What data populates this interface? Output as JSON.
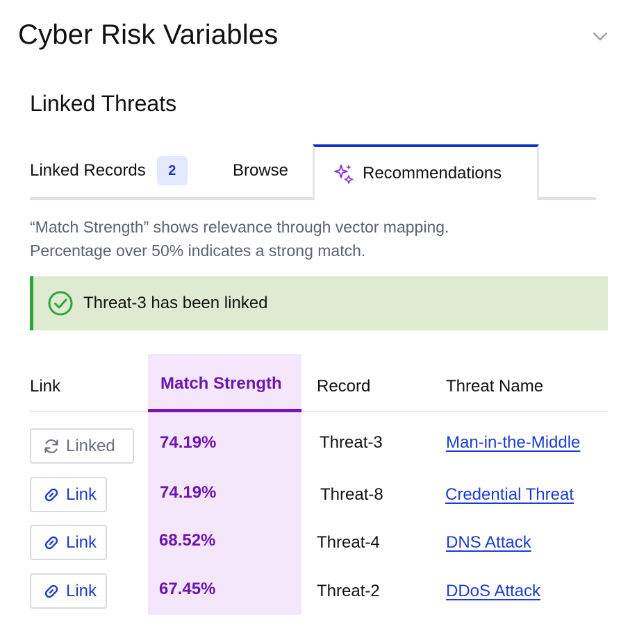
{
  "panel": {
    "title": "Cyber Risk Variables",
    "collapse_icon": "chevron-down-icon"
  },
  "section": {
    "title": "Linked Threats"
  },
  "tabs": {
    "linked_records": {
      "label": "Linked Records",
      "count": "2"
    },
    "browse": {
      "label": "Browse"
    },
    "recommendations": {
      "label": "Recommendations",
      "icon": "sparkle-icon",
      "active": true
    }
  },
  "hint": {
    "line1": "“Match Strength” shows relevance through vector mapping.",
    "line2": "Percentage over 50% indicates a strong match."
  },
  "alert": {
    "text": "Threat-3 has been linked",
    "icon": "check-circle-icon",
    "color": "#2ea43a"
  },
  "table": {
    "headers": {
      "link": "Link",
      "match": "Match Strength",
      "record": "Record",
      "threat": "Threat Name"
    },
    "rows": [
      {
        "action": "Linked",
        "action_icon": "refresh-icon",
        "match": "74.19%",
        "record": "Threat-3",
        "threat": "Man-in-the-Middle"
      },
      {
        "action": "Link",
        "action_icon": "link-icon",
        "match": "74.19%",
        "record": "Threat-8",
        "threat": "Credential Threat"
      },
      {
        "action": "Link",
        "action_icon": "link-icon",
        "match": "68.52%",
        "record": "Threat-4",
        "threat": "DNS Attack"
      },
      {
        "action": "Link",
        "action_icon": "link-icon",
        "match": "67.45%",
        "record": "Threat-2",
        "threat": "DDoS Attack"
      }
    ]
  },
  "colors": {
    "accent_blue": "#1b3ed1",
    "accent_purple": "#6e15b0",
    "highlight_bg": "#f4e7fb",
    "success_bg": "#deebd0"
  }
}
